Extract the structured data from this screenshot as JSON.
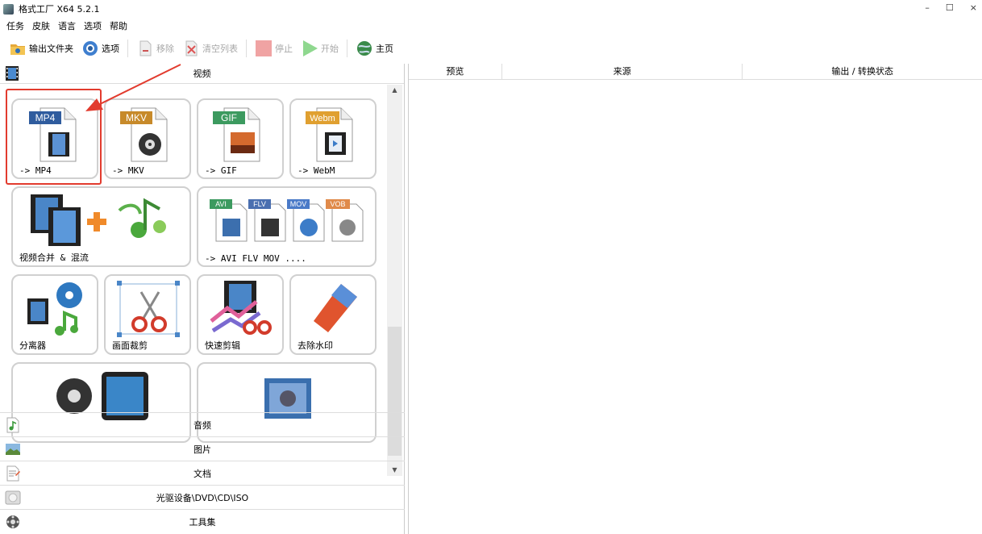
{
  "window": {
    "title": "格式工厂 X64 5.2.1",
    "controls": [
      "–",
      "☐",
      "×"
    ]
  },
  "menu": [
    "任务",
    "皮肤",
    "语言",
    "选项",
    "帮助"
  ],
  "toolbar": {
    "output_folder": "输出文件夹",
    "options": "选项",
    "remove": "移除",
    "clear_list": "清空列表",
    "stop": "停止",
    "start": "开始",
    "home": "主页"
  },
  "left": {
    "video_header": "视频",
    "tiles": {
      "mp4": {
        "badge": "MP4",
        "label": "-> MP4"
      },
      "mkv": {
        "badge": "MKV",
        "label": "-> MKV"
      },
      "gif": {
        "badge": "GIF",
        "label": "-> GIF"
      },
      "webm": {
        "badge": "Webm",
        "label": "-> WebM"
      },
      "merge": {
        "label": "视频合并 & 混流"
      },
      "multi": {
        "badges": [
          "AVI",
          "FLV",
          "MOV",
          "VOB"
        ],
        "label": "-> AVI FLV MOV ...."
      },
      "splitter": {
        "label": "分离器"
      },
      "crop": {
        "label": "画面裁剪"
      },
      "quick_cut": {
        "label": "快速剪辑"
      },
      "remove_watermark": {
        "label": "去除水印"
      }
    },
    "categories": [
      "音频",
      "图片",
      "文档",
      "光驱设备\\DVD\\CD\\ISO",
      "工具集"
    ]
  },
  "right": {
    "columns": [
      "预览",
      "来源",
      "输出 / 转换状态"
    ]
  },
  "colors": {
    "highlight": "#e23b2e",
    "mp4_badge": "#2f5c9e",
    "mkv_badge": "#c78a2a",
    "gif_badge": "#3c9a5f",
    "webm_badge": "#e0a030"
  }
}
